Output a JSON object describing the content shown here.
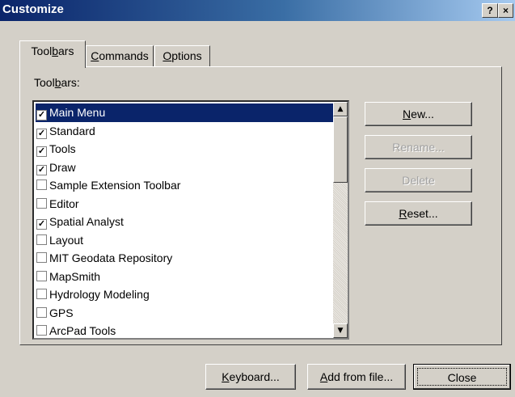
{
  "window": {
    "title": "Customize",
    "help": "?",
    "close": "×"
  },
  "tabs": [
    {
      "pre": "Tool",
      "acc": "b",
      "post": "ars"
    },
    {
      "pre": "",
      "acc": "C",
      "post": "ommands"
    },
    {
      "pre": "",
      "acc": "O",
      "post": "ptions"
    }
  ],
  "toolbars_label": {
    "pre": "Tool",
    "acc": "b",
    "post": "ars:"
  },
  "toolbars": [
    {
      "label": "Main Menu",
      "checked": true
    },
    {
      "label": "Standard",
      "checked": true
    },
    {
      "label": "Tools",
      "checked": true
    },
    {
      "label": "Draw",
      "checked": true
    },
    {
      "label": "Sample Extension Toolbar",
      "checked": false
    },
    {
      "label": "Editor",
      "checked": false
    },
    {
      "label": "Spatial Analyst",
      "checked": true
    },
    {
      "label": "Layout",
      "checked": false
    },
    {
      "label": "MIT Geodata Repository",
      "checked": false
    },
    {
      "label": "MapSmith",
      "checked": false
    },
    {
      "label": "Hydrology Modeling",
      "checked": false
    },
    {
      "label": "GPS",
      "checked": false
    },
    {
      "label": "ArcPad Tools",
      "checked": false
    }
  ],
  "side_buttons": {
    "new": {
      "acc": "N",
      "post": "ew..."
    },
    "rename": "Rename...",
    "delete": "Delete",
    "reset": {
      "acc": "R",
      "post": "eset..."
    }
  },
  "bottom_buttons": {
    "keyboard": {
      "acc": "K",
      "post": "eyboard..."
    },
    "add_from_file": {
      "acc": "A",
      "post": "dd from file..."
    },
    "close": "Close"
  }
}
